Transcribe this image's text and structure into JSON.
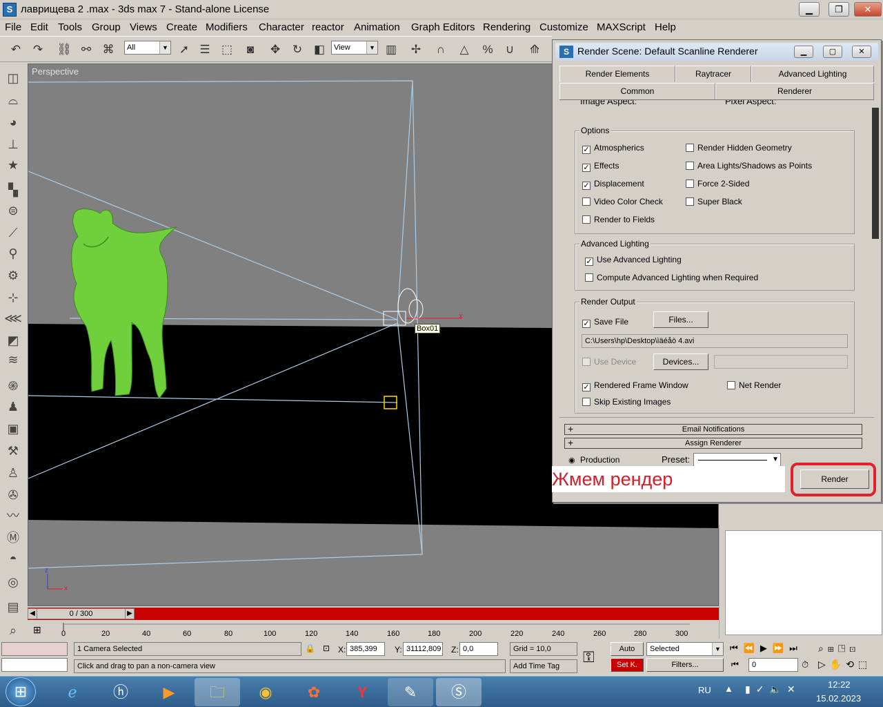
{
  "window": {
    "title": "лаврищева 2 .max - 3ds max 7  - Stand-alone License"
  },
  "menu": [
    "File",
    "Edit",
    "Tools",
    "Group",
    "Views",
    "Create",
    "Modifiers",
    "Character",
    "reactor",
    "Animation",
    "Graph Editors",
    "Rendering",
    "Customize",
    "MAXScript",
    "Help"
  ],
  "toolbar": {
    "selection_filter": "All",
    "ref_coord": "View"
  },
  "viewport": {
    "label": "Perspective",
    "object_label": "Box01"
  },
  "timeline": {
    "frame_display": "0 / 300",
    "ticks": [
      "20",
      "40",
      "60",
      "80",
      "100",
      "120",
      "140",
      "160",
      "180",
      "200",
      "220",
      "240",
      "260",
      "280",
      "300"
    ],
    "zero": "0"
  },
  "status": {
    "selection": "1 Camera Selected",
    "prompt": "Click and drag to pan a non-camera view",
    "x_label": "X:",
    "x_value": "385,399",
    "y_label": "Y:",
    "y_value": "31112,809",
    "z_label": "Z:",
    "z_value": "0,0",
    "grid": "Grid = 10,0",
    "add_time_tag": "Add Time Tag",
    "auto_key": "Auto",
    "set_key": "Set K.",
    "key_filter": "Selected",
    "filters_button": "Filters...",
    "frame_field": "0"
  },
  "dialog": {
    "title": "Render Scene: Default Scanline Renderer",
    "tabs_row1": [
      "Render Elements",
      "Raytracer",
      "Advanced Lighting"
    ],
    "tabs_row2": [
      "Common",
      "Renderer"
    ],
    "partial_row": {
      "image_aspect": "Image Aspect:",
      "pixel_aspect": "Pixel Aspect:"
    },
    "options": {
      "title": "Options",
      "left": [
        {
          "label": "Atmospherics",
          "checked": true
        },
        {
          "label": "Effects",
          "checked": true
        },
        {
          "label": "Displacement",
          "checked": true
        },
        {
          "label": "Video Color Check",
          "checked": false
        },
        {
          "label": "Render to Fields",
          "checked": false
        }
      ],
      "right": [
        {
          "label": "Render Hidden Geometry",
          "checked": false
        },
        {
          "label": "Area Lights/Shadows as Points",
          "checked": false
        },
        {
          "label": "Force 2-Sided",
          "checked": false
        },
        {
          "label": "Super Black",
          "checked": false
        }
      ]
    },
    "advanced_lighting": {
      "title": "Advanced Lighting",
      "use": {
        "label": "Use Advanced Lighting",
        "checked": true
      },
      "compute": {
        "label": "Compute Advanced Lighting when Required",
        "checked": false
      }
    },
    "render_output": {
      "title": "Render Output",
      "save_file": {
        "label": "Save File",
        "checked": true
      },
      "files_button": "Files...",
      "path": "C:\\Users\\hp\\Desktop\\ìäéåò 4.avi",
      "use_device": {
        "label": "Use Device",
        "checked": false
      },
      "devices_button": "Devices...",
      "rendered_frame_window": {
        "label": "Rendered Frame Window",
        "checked": true
      },
      "net_render": {
        "label": "Net Render",
        "checked": false
      },
      "skip_existing": {
        "label": "Skip Existing Images",
        "checked": false
      }
    },
    "rollouts": [
      "Email Notifications",
      "Assign Renderer"
    ],
    "production_label": "Production",
    "preset_label": "Preset:",
    "render_button": "Render"
  },
  "annotation": {
    "text": "Жмем рендер",
    "color": "#d0202a"
  },
  "tray": {
    "lang": "RU",
    "time": "12:22",
    "date": "15.02.2023"
  }
}
